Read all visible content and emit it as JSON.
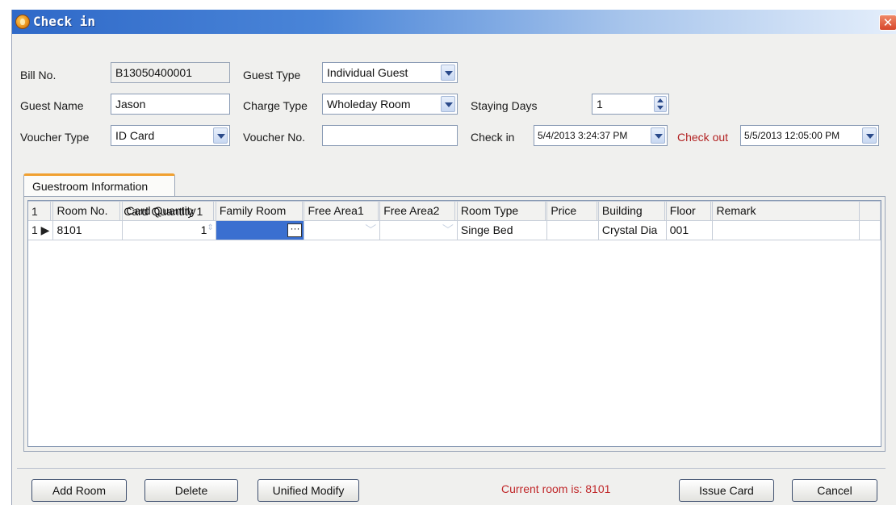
{
  "window": {
    "title": "Check in",
    "close_glyph": "✕"
  },
  "form": {
    "bill_no_label": "Bill No.",
    "bill_no_value": "B13050400001",
    "guest_type_label": "Guest Type",
    "guest_type_value": "Individual Guest",
    "guest_name_label": "Guest Name",
    "guest_name_value": "Jason",
    "charge_type_label": "Charge Type",
    "charge_type_value": "Wholeday Room",
    "staying_days_label": "Staying Days",
    "staying_days_value": "1",
    "voucher_type_label": "Voucher Type",
    "voucher_type_value": "ID Card",
    "voucher_no_label": "Voucher No.",
    "voucher_no_value": "",
    "check_in_label": "Check in",
    "check_in_value": "5/4/2013 3:24:37 PM",
    "check_out_label": "Check out",
    "check_out_value": "5/5/2013 12:05:00 PM"
  },
  "tab": {
    "label": "Guestroom Information"
  },
  "grid": {
    "columns": [
      "Room No.",
      "Card Quantity",
      "Family Room",
      "Free Area1",
      "Free Area2",
      "Room Type",
      "Price",
      "Building",
      "Floor",
      "Remark"
    ],
    "rows": [
      {
        "index": "1",
        "room_no": "8101",
        "card_quantity": "1",
        "family_room": "",
        "free_area1": "",
        "free_area2": "",
        "room_type": "Singe Bed",
        "price": "",
        "building": "Crystal Dia",
        "floor": "001",
        "remark": ""
      }
    ],
    "footer": {
      "count": "1",
      "summary": "Card Quantity 1"
    },
    "ellipsis_glyph": "···"
  },
  "buttons": {
    "add_room": "Add Room",
    "delete": "Delete",
    "unified_modify": "Unified Modify",
    "issue_card": "Issue Card",
    "cancel": "Cancel"
  },
  "status": {
    "current_room": "Current room is:  8101"
  },
  "colors": {
    "accent_red": "#b22222",
    "title_blue": "#2f69c8",
    "selection": "#3a6fd0",
    "tab_accent": "#f0a030"
  }
}
